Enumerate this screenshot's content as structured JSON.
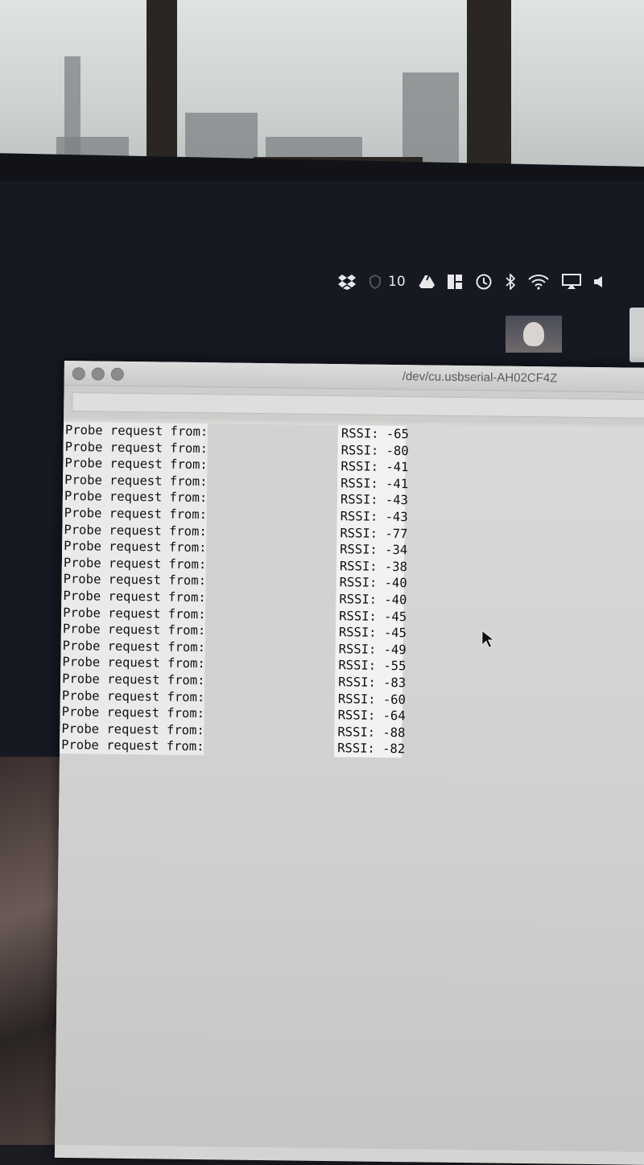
{
  "menubar": {
    "icons": [
      "dropbox-icon",
      "shield-icon",
      "google-drive-icon",
      "grid-app-icon",
      "time-machine-icon",
      "bluetooth-icon",
      "wifi-icon",
      "airplay-icon",
      "volume-icon"
    ],
    "badge_count": "10"
  },
  "window": {
    "title": "/dev/cu.usbserial-AH02CF4Z",
    "send_input_value": ""
  },
  "serial_output": {
    "lines": [
      {
        "prefix": "Probe request from:",
        "rssi": "RSSI: -65"
      },
      {
        "prefix": "Probe request from:",
        "rssi": "RSSI: -80"
      },
      {
        "prefix": "Probe request from:",
        "rssi": "RSSI: -41"
      },
      {
        "prefix": "Probe request from:",
        "rssi": "RSSI: -41"
      },
      {
        "prefix": "Probe request from:",
        "rssi": "RSSI: -43"
      },
      {
        "prefix": "Probe request from:",
        "rssi": "RSSI: -43"
      },
      {
        "prefix": "Probe request from:",
        "rssi": "RSSI: -77"
      },
      {
        "prefix": "Probe request from:",
        "rssi": "RSSI: -34"
      },
      {
        "prefix": "Probe request from:",
        "rssi": "RSSI: -38"
      },
      {
        "prefix": "Probe request from:",
        "rssi": "RSSI: -40"
      },
      {
        "prefix": "Probe request from:",
        "rssi": "RSSI: -40"
      },
      {
        "prefix": "Probe request from:",
        "rssi": "RSSI: -45"
      },
      {
        "prefix": "Probe request from:",
        "rssi": "RSSI: -45"
      },
      {
        "prefix": "Probe request from:",
        "rssi": "RSSI: -49"
      },
      {
        "prefix": "Probe request from:",
        "rssi": "RSSI: -55"
      },
      {
        "prefix": "Probe request from:",
        "rssi": "RSSI: -83"
      },
      {
        "prefix": "Probe request from:",
        "rssi": "RSSI: -60"
      },
      {
        "prefix": "Probe request from:",
        "rssi": "RSSI: -64"
      },
      {
        "prefix": "Probe request from:",
        "rssi": "RSSI: -88"
      },
      {
        "prefix": "Probe request from:",
        "rssi": "RSSI: -82"
      }
    ]
  },
  "colors": {
    "desktop": "#161822",
    "window_bg": "#d4d4d2",
    "output_bg": "#eaeaea"
  }
}
